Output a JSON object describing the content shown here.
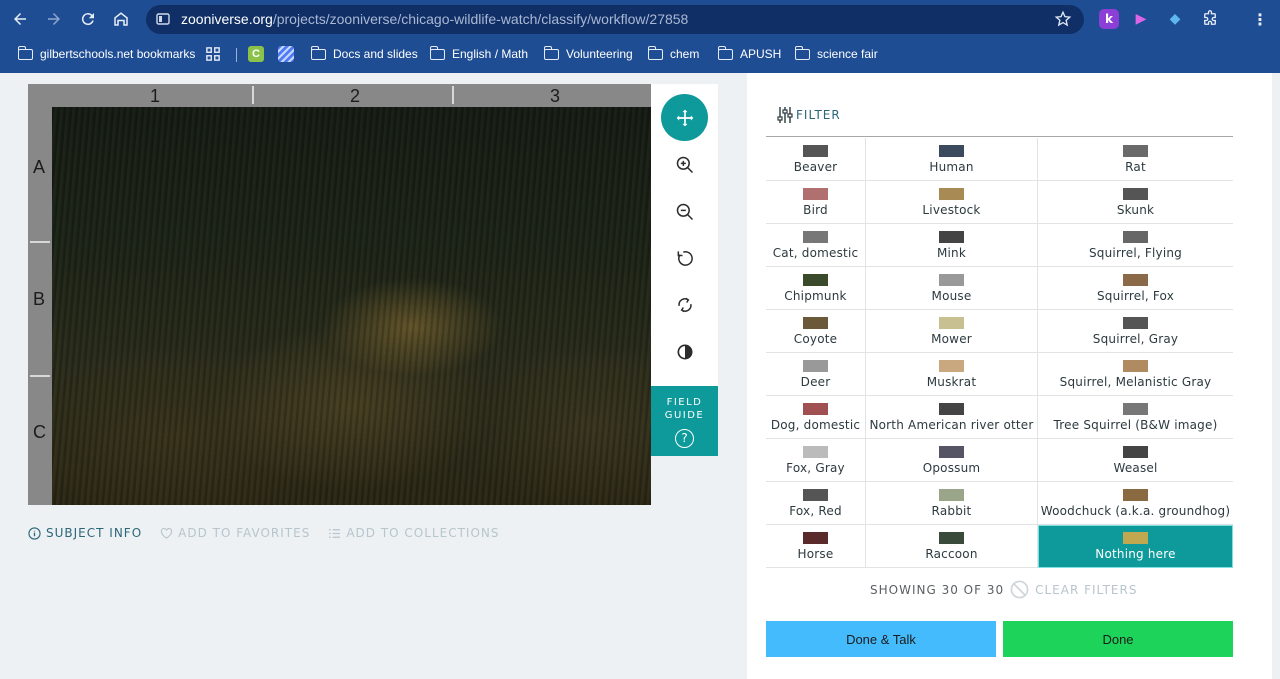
{
  "browser": {
    "url_host": "zooniverse.org",
    "url_path": "/projects/zooniverse/chicago-wildlife-watch/classify/workflow/27858",
    "extensions": [
      {
        "icon": "k-extension-icon",
        "letter": "k",
        "color": "#8b3fd6"
      },
      {
        "icon": "video-extension-icon",
        "letter": "▶",
        "color": "#c53bd1"
      },
      {
        "icon": "colorful-extension-icon",
        "letter": "◆",
        "color": "#2c8fd1"
      },
      {
        "icon": "puzzle-icon",
        "letter": "",
        "color": ""
      }
    ]
  },
  "bookmarks": [
    {
      "label": "gilbertschools.net bookmarks",
      "icon": "managed-folder-icon"
    },
    {
      "label": "",
      "icon": "apps-grid-icon"
    },
    {
      "label": "",
      "icon": "c-app-icon"
    },
    {
      "label": "",
      "icon": "striped-app-icon"
    },
    {
      "label": "Docs and slides",
      "icon": "folder-icon"
    },
    {
      "label": "English / Math",
      "icon": "folder-icon"
    },
    {
      "label": "Volunteering",
      "icon": "folder-icon"
    },
    {
      "label": "chem",
      "icon": "folder-icon"
    },
    {
      "label": "APUSH",
      "icon": "folder-icon"
    },
    {
      "label": "science fair",
      "icon": "folder-icon"
    }
  ],
  "viewer": {
    "columns": [
      "1",
      "2",
      "3"
    ],
    "rows": [
      "A",
      "B",
      "C"
    ],
    "field_guide_label": "FIELD GUIDE",
    "field_guide_icon": "?"
  },
  "meta": {
    "subject_info": "SUBJECT INFO",
    "add_favorites": "ADD TO FAVORITES",
    "add_collections": "ADD TO COLLECTIONS"
  },
  "panel": {
    "filter_label": "FILTER",
    "choices": [
      [
        "Beaver",
        "Human",
        "Rat"
      ],
      [
        "Bird",
        "Livestock",
        "Skunk"
      ],
      [
        "Cat, domestic",
        "Mink",
        "Squirrel, Flying"
      ],
      [
        "Chipmunk",
        "Mouse",
        "Squirrel, Fox"
      ],
      [
        "Coyote",
        "Mower",
        "Squirrel, Gray"
      ],
      [
        "Deer",
        "Muskrat",
        "Squirrel, Melanistic Gray"
      ],
      [
        "Dog, domestic",
        "North American river otter",
        "Tree Squirrel (B&W image)"
      ],
      [
        "Fox, Gray",
        "Opossum",
        "Weasel"
      ],
      [
        "Fox, Red",
        "Rabbit",
        "Woodchuck (a.k.a. groundhog)"
      ],
      [
        "Horse",
        "Raccoon",
        "Nothing here"
      ]
    ],
    "selected_choice": "Nothing here",
    "showing_text": "SHOWING 30 OF 30",
    "clear_filters": "CLEAR FILTERS",
    "done_talk": "Done & Talk",
    "done": "Done"
  },
  "colors": {
    "teal_accent": "#0e9a9b",
    "done_talk_blue": "#43bbfd",
    "done_green": "#1ed359",
    "browser_blue": "#1f4d94"
  }
}
